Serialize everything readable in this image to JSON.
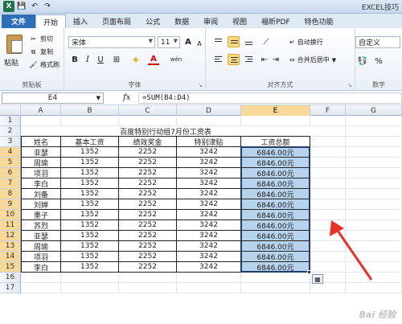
{
  "window": {
    "title": "EXCEL技巧"
  },
  "qat": {
    "logo": "X",
    "save": "💾",
    "undo": "↶",
    "redo": "↷"
  },
  "tabs": [
    "文件",
    "开始",
    "插入",
    "页面布局",
    "公式",
    "数据",
    "审阅",
    "视图",
    "福昕PDF",
    "特色功能"
  ],
  "ribbon": {
    "clipboard": {
      "paste": "粘贴",
      "cut": "剪切",
      "copy": "复制",
      "format_painter": "格式刷",
      "label": "剪贴板"
    },
    "font": {
      "name": "宋体",
      "size": "11",
      "label": "字体",
      "grow": "A",
      "shrink": "A",
      "bold": "B",
      "italic": "I",
      "underline": "U",
      "font_color": "A",
      "wen": "wén"
    },
    "alignment": {
      "wrap": "自动换行",
      "merge": "合并后居中",
      "label": "对齐方式"
    },
    "number": {
      "format": "自定义",
      "label": "数字"
    }
  },
  "formula_bar": {
    "name_box": "E4",
    "fx": "fx",
    "formula": "=SUM(B4:D4)"
  },
  "columns": [
    "A",
    "B",
    "C",
    "D",
    "E",
    "F",
    "G"
  ],
  "rows": [
    "1",
    "2",
    "3",
    "4",
    "5",
    "6",
    "7",
    "8",
    "9",
    "10",
    "11",
    "12",
    "13",
    "14",
    "15",
    "16",
    "17"
  ],
  "sheet": {
    "title": "百度特别行动组7月份工资表",
    "headers": [
      "姓名",
      "基本工资",
      "绩效奖金",
      "特别津贴",
      "工资总额"
    ],
    "records": [
      [
        "亚瑟",
        "1352",
        "2252",
        "3242",
        "6846.00元"
      ],
      [
        "周瑜",
        "1352",
        "2252",
        "3242",
        "6846.00元"
      ],
      [
        "项羽",
        "1352",
        "2252",
        "3242",
        "6846.00元"
      ],
      [
        "李白",
        "1352",
        "2252",
        "3242",
        "6846.00元"
      ],
      [
        "刘备",
        "1352",
        "2252",
        "3242",
        "6846.00元"
      ],
      [
        "刘婵",
        "1352",
        "2252",
        "3242",
        "6846.00元"
      ],
      [
        "墨子",
        "1352",
        "2252",
        "3242",
        "6846.00元"
      ],
      [
        "苏烈",
        "1352",
        "2252",
        "3242",
        "6846.00元"
      ],
      [
        "亚瑟",
        "1352",
        "2252",
        "3242",
        "6846.00元"
      ],
      [
        "周瑜",
        "1352",
        "2252",
        "3242",
        "6846.00元"
      ],
      [
        "项羽",
        "1352",
        "2252",
        "3242",
        "6846.00元"
      ],
      [
        "李白",
        "1352",
        "2252",
        "3242",
        "6846.00元"
      ]
    ]
  },
  "watermark": "Bai 经验",
  "colors": {
    "selection_fill": "#b7d3ee",
    "header_highlight": "#f9d99a",
    "file_tab": "#2a6fb8",
    "arrow": "#e8322a"
  }
}
